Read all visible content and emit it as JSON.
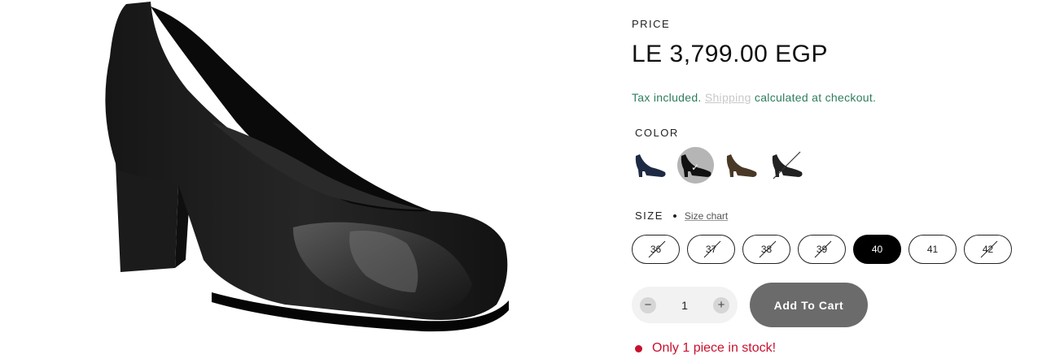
{
  "product": {
    "image_icon": "black-pump-heel-shoe-image"
  },
  "price_section": {
    "label": "PRICE",
    "price": "LE 3,799.00 EGP"
  },
  "tax_note": {
    "prefix": "Tax included.",
    "shipping_link": "Shipping",
    "suffix": "calculated at checkout."
  },
  "color": {
    "label": "COLOR",
    "swatches": [
      {
        "name": "navy-pump-icon",
        "color": "#1e2a44",
        "selected": false,
        "available": true
      },
      {
        "name": "black-pump-icon",
        "color": "#111111",
        "selected": true,
        "available": true
      },
      {
        "name": "brown-pump-icon",
        "color": "#4a3826",
        "selected": false,
        "available": true
      },
      {
        "name": "black-patent-pump-icon",
        "color": "#222222",
        "selected": false,
        "available": false
      }
    ]
  },
  "size": {
    "label": "SIZE",
    "chart_link": "Size chart",
    "options": [
      {
        "label": "36",
        "available": false,
        "selected": false
      },
      {
        "label": "37",
        "available": false,
        "selected": false
      },
      {
        "label": "38",
        "available": false,
        "selected": false
      },
      {
        "label": "39",
        "available": false,
        "selected": false
      },
      {
        "label": "40",
        "available": true,
        "selected": true
      },
      {
        "label": "41",
        "available": true,
        "selected": false
      },
      {
        "label": "42",
        "available": false,
        "selected": false
      }
    ]
  },
  "quantity": {
    "minus": "−",
    "value": "1",
    "plus": "+"
  },
  "cart": {
    "add_label": "Add To Cart"
  },
  "stock": {
    "message": "Only 1 piece in stock!",
    "status_color": "#c8102e"
  }
}
